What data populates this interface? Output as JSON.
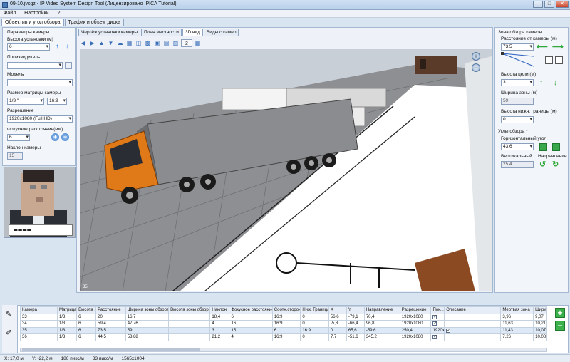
{
  "window": {
    "title": "09-10.jvsgz - IP Video System Design Tool (Лицензировано  IPICA Tutorial)",
    "min_btn": "–",
    "max_btn": "□",
    "close_btn": "✕"
  },
  "menu": [
    "Файл",
    "Настройки",
    "?"
  ],
  "main_tabs": [
    "Объектив и угол обзора",
    "Трафик и объем диска"
  ],
  "left": {
    "section_title": "Параметры камеры",
    "height_label": "Высота установки (м)",
    "height_value": "6",
    "vendor_label": "Производитель",
    "vendor_value": "",
    "vendor_btn": "...",
    "model_label": "Модель",
    "model_value": "",
    "sensor_label": "Размер матрицы камеры",
    "sensor_value": "1/3 \"",
    "sensor_ratio": "16:9",
    "resolution_label": "Разрешение",
    "resolution_value": "1920x1080 (Full HD)",
    "focal_label": "Фокусное расстояние(мм)",
    "focal_value": "6",
    "tilt_label": "Наклон камеры",
    "tilt_value": "15"
  },
  "plate_text": "▬▬▬▬",
  "view_tabs": [
    "Чертёж установки камеры",
    "План местности",
    "3D вид",
    "Виды с камер"
  ],
  "toolbar_icons": [
    "◀",
    "▶",
    "▲",
    "▼",
    "☁",
    "▦",
    "◫",
    "▩",
    "▣",
    "▤",
    "▥",
    "▦"
  ],
  "toolbar_combo": "2",
  "zoom_in": "+",
  "zoom_out": "−",
  "scene_label": "35",
  "right": {
    "title": "Зона обзора камеры",
    "distance_label": "Расстояние от камеры (м)",
    "distance_value": "73,5",
    "target_height_label": "Высота цели (м)",
    "target_height_value": "3",
    "zone_width_label": "Ширина зоны (м)",
    "zone_width_value": "59",
    "lower_bound_label": "Высота нижн. границы (м)",
    "lower_bound_value": "0",
    "angles_title": "Углы обзора *",
    "horizontal_label": "Горизонтальный угол",
    "horizontal_value": "43,6",
    "vertical_label": "Вертикальный",
    "vertical_value": "25,4",
    "direction_label": "Направление"
  },
  "table": {
    "headers": [
      "Камера",
      "Матрица",
      "Высота ...",
      "Расстояние",
      "Ширина зоны обзора",
      "Высота зоны обзора",
      "Наклон",
      "Фокусное расстояние",
      "Соотн.сторон",
      "Ниж. Граница",
      "X",
      "Y",
      "Направление",
      "Разрешение",
      "Пок...",
      "Описание",
      "Мертвая зона",
      "Ширин"
    ],
    "rows": [
      [
        "33",
        "1/3",
        "6",
        "20",
        "16,7",
        "",
        "18,4",
        "6",
        "16:9",
        "0",
        "56,6",
        "-79,1",
        "70,4",
        "1920x1080",
        "✓",
        "",
        "3,96",
        "9,07"
      ],
      [
        "34",
        "1/3",
        "6",
        "59,4",
        "47,76",
        "",
        "4",
        "16",
        "16:9",
        "0",
        "-5,8",
        "-66,4",
        "96,8",
        "1920x1080",
        "✓",
        "",
        "11,63",
        "10,21"
      ],
      [
        "35",
        "1/3",
        "6",
        "73,5",
        "59",
        "",
        "3",
        "15",
        "6",
        "16:9",
        "0",
        "65,6",
        "-59,6",
        "250,4",
        "1920x1080",
        "✓",
        "11,43",
        "10,07"
      ],
      [
        "36",
        "1/3",
        "6",
        "44,5",
        "53,88",
        "",
        "21,2",
        "4",
        "16:9",
        "0",
        "7,7",
        "-51,6",
        "345,2",
        "1920x1080",
        "✓",
        "",
        "7,26",
        "10,08"
      ]
    ]
  },
  "status": {
    "x": "X: 17,0 м",
    "y": "Y: -22,2 м",
    "density": "186 пикс/м",
    "density2": "33 пикс/м",
    "size": "1565x1004"
  }
}
